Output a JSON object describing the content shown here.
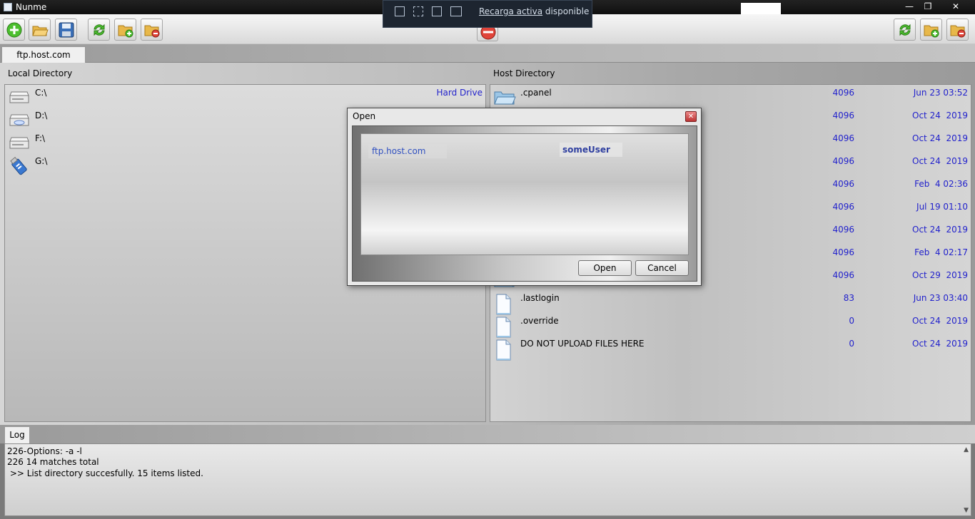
{
  "window": {
    "title": "Nunme",
    "minimize": "—",
    "maximize": "❐",
    "close": "✕"
  },
  "overlay": {
    "link": "Recarga activa",
    "rest": " disponible"
  },
  "tabs": {
    "host": "ftp.host.com"
  },
  "local": {
    "label": "Local Directory",
    "drives": [
      {
        "name": "C:\\",
        "type": "Hard Drive",
        "icon": "hard-drive-icon"
      },
      {
        "name": "D:\\",
        "type": "",
        "icon": "optical-drive-icon"
      },
      {
        "name": "F:\\",
        "type": "",
        "icon": "hard-drive-icon"
      },
      {
        "name": "G:\\",
        "type": "",
        "icon": "usb-drive-icon"
      }
    ]
  },
  "host": {
    "label": "Host Directory",
    "entries": [
      {
        "name": ".cpanel",
        "size": "4096",
        "date": "Jun 23 03:52",
        "icon": "folder-icon"
      },
      {
        "name": "",
        "size": "4096",
        "date": "Oct 24  2019",
        "icon": "folder-icon"
      },
      {
        "name": "",
        "size": "4096",
        "date": "Oct 24  2019",
        "icon": "folder-icon"
      },
      {
        "name": "",
        "size": "4096",
        "date": "Oct 24  2019",
        "icon": "folder-icon"
      },
      {
        "name": "",
        "size": "4096",
        "date": "Feb  4 02:36",
        "icon": "folder-icon"
      },
      {
        "name": "",
        "size": "4096",
        "date": "Jul 19 01:10",
        "icon": "folder-icon"
      },
      {
        "name": "",
        "size": "4096",
        "date": "Oct 24  2019",
        "icon": "folder-icon"
      },
      {
        "name": "",
        "size": "4096",
        "date": "Feb  4 02:17",
        "icon": "folder-icon"
      },
      {
        "name": "",
        "size": "4096",
        "date": "Oct 29  2019",
        "icon": "folder-icon"
      },
      {
        "name": ".lastlogin",
        "size": "83",
        "date": "Jun 23 03:40",
        "icon": "file-icon"
      },
      {
        "name": ".override",
        "size": "0",
        "date": "Oct 24  2019",
        "icon": "file-icon"
      },
      {
        "name": "DO NOT UPLOAD FILES HERE",
        "size": "0",
        "date": "Oct 24  2019",
        "icon": "file-icon"
      }
    ]
  },
  "log": {
    "tab": "Log",
    "lines": [
      "226-Options: -a -l",
      "226 14 matches total",
      " >> List directory succesfully. 15 items listed."
    ]
  },
  "dialog": {
    "title": "Open",
    "entry_host": "ftp.host.com",
    "entry_user": "someUser",
    "open_label": "Open",
    "cancel_label": "Cancel"
  },
  "colors": {
    "accent_text": "#2222cc",
    "link_blue": "#3050c0"
  }
}
